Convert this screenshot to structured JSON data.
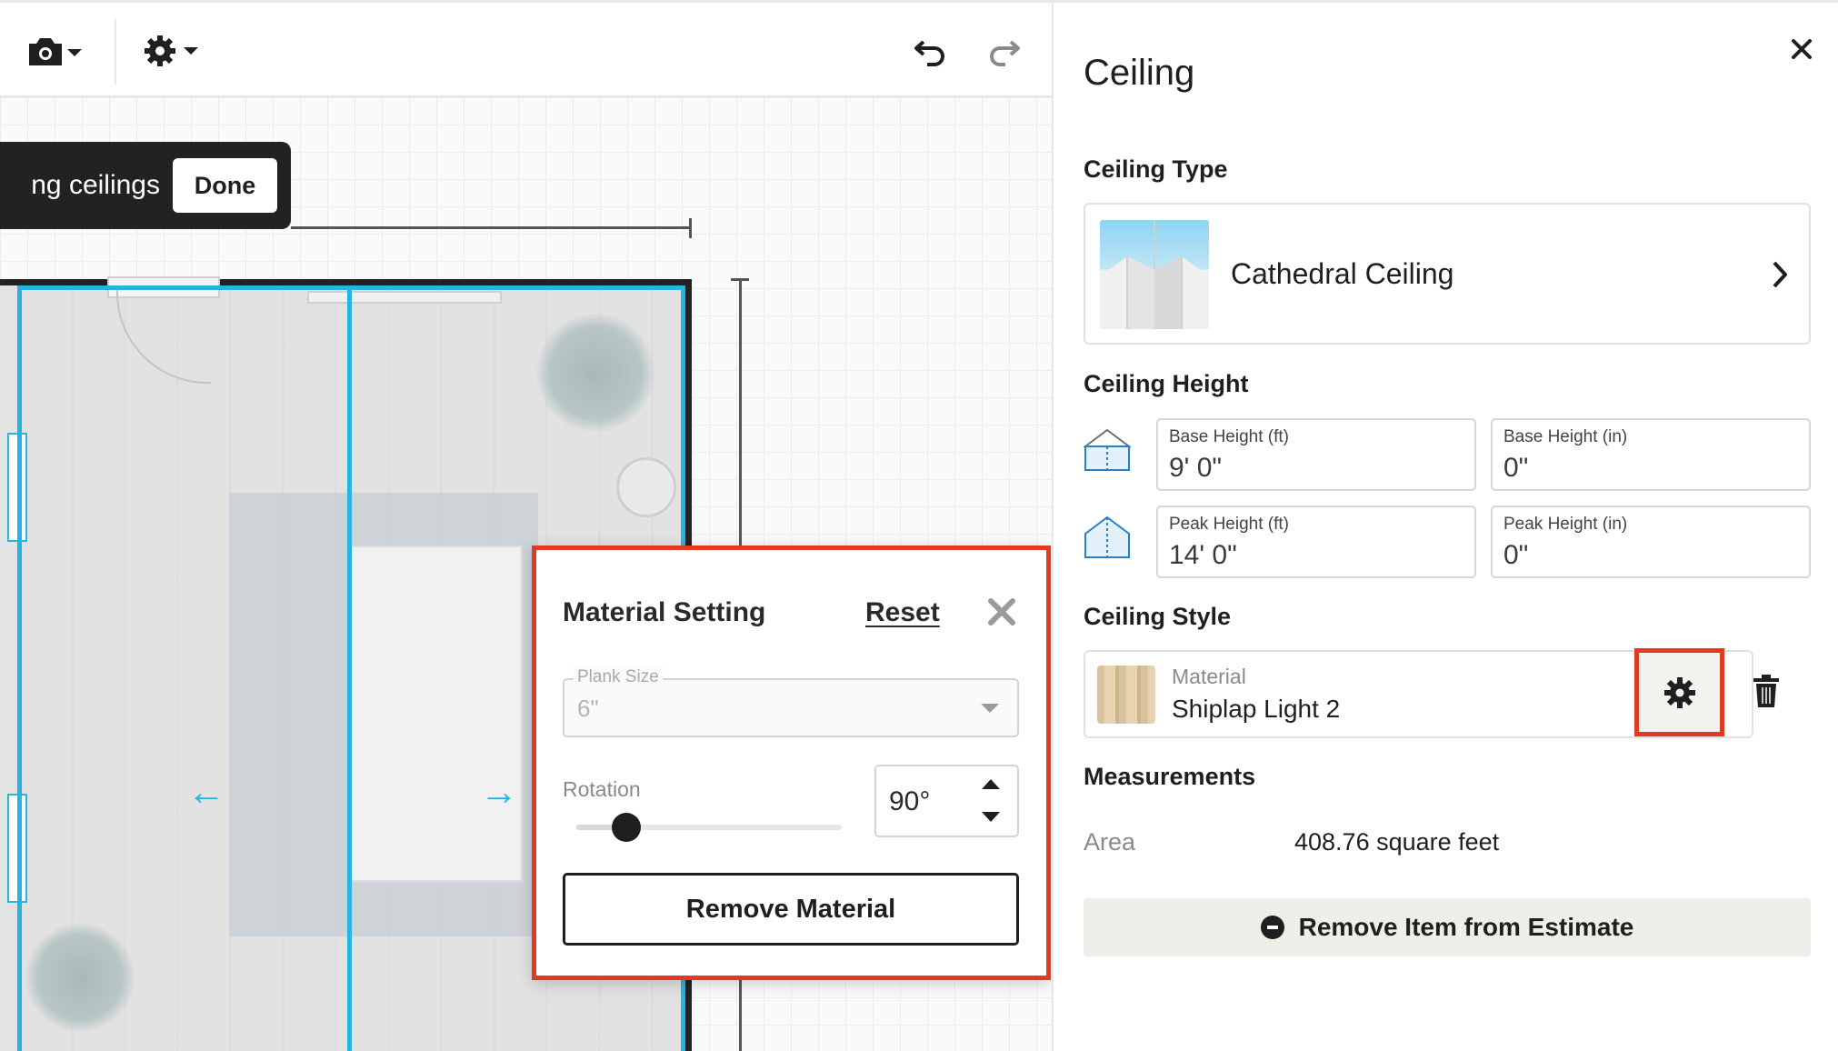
{
  "banner": {
    "text": "ng ceilings",
    "done_label": "Done"
  },
  "popup": {
    "title": "Material Setting",
    "reset_label": "Reset",
    "plank_size": {
      "label": "Plank Size",
      "value": "6\""
    },
    "rotation": {
      "label": "Rotation",
      "value": "90°",
      "slider_fraction": 0.19
    },
    "remove_label": "Remove Material"
  },
  "panel": {
    "title": "Ceiling",
    "ceiling_type": {
      "heading": "Ceiling Type",
      "name": "Cathedral Ceiling"
    },
    "ceiling_height": {
      "heading": "Ceiling Height",
      "base_ft": {
        "label": "Base Height (ft)",
        "value": "9' 0\""
      },
      "base_in": {
        "label": "Base Height (in)",
        "value": "0\""
      },
      "peak_ft": {
        "label": "Peak Height (ft)",
        "value": "14' 0\""
      },
      "peak_in": {
        "label": "Peak Height (in)",
        "value": "0\""
      }
    },
    "ceiling_style": {
      "heading": "Ceiling Style",
      "material_label": "Material",
      "material_name": "Shiplap Light 2"
    },
    "measurements": {
      "heading": "Measurements",
      "area_label": "Area",
      "area_value": "408.76 square feet"
    },
    "remove_estimate_label": "Remove Item from Estimate"
  },
  "colors": {
    "accent": "#26b5e2",
    "highlight": "#e03a22",
    "banner_bg": "#222222"
  },
  "icons": [
    "camera-icon",
    "settings-icon",
    "undo-icon",
    "redo-icon",
    "close-icon",
    "chevron-right-icon",
    "base-height-icon",
    "peak-height-icon",
    "gear-icon",
    "trash-icon",
    "minus-circle-icon"
  ]
}
